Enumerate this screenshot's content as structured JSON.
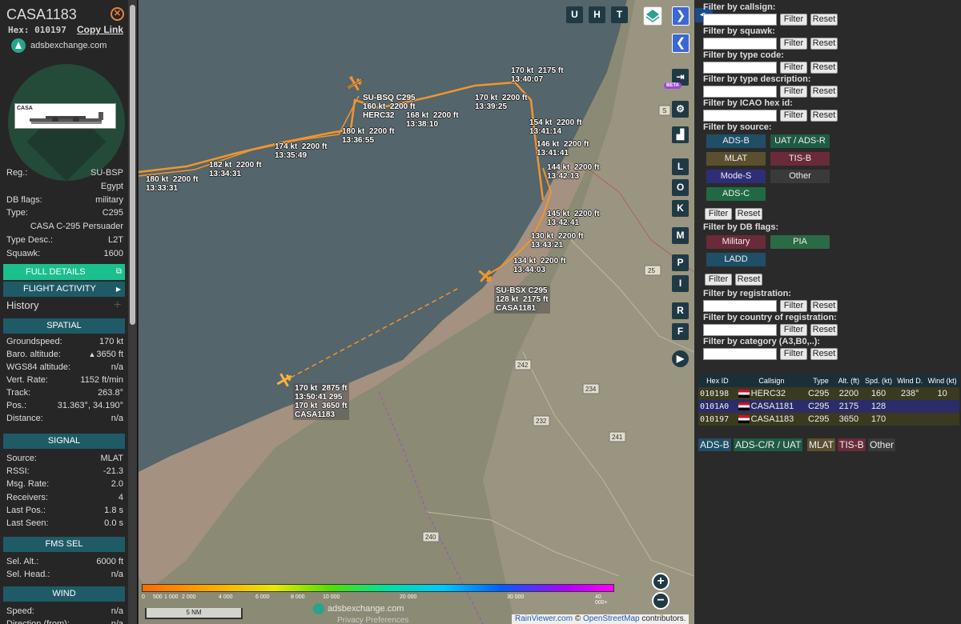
{
  "info": {
    "callsign": "CASA1183",
    "hex_label": "Hex:",
    "hex": "010197",
    "copy_link": "Copy Link",
    "brand": "adsbexchange.com",
    "photo_text": "CASA",
    "fields": [
      {
        "k": "Reg.:",
        "v": "SU-BSP"
      },
      {
        "k": "",
        "v": "Egypt"
      },
      {
        "k": "DB flags:",
        "v": "military"
      },
      {
        "k": "Type:",
        "v": "C295"
      },
      {
        "k": "",
        "v": "CASA C-295 Persuader"
      },
      {
        "k": "Type Desc.:",
        "v": "L2T"
      },
      {
        "k": "Squawk:",
        "v": "1600"
      }
    ],
    "full_details": "FULL DETAILS",
    "flight_activity": "FLIGHT ACTIVITY",
    "history": "History",
    "spatial_header": "SPATIAL",
    "spatial": [
      {
        "k": "Groundspeed:",
        "v": "170 kt"
      },
      {
        "k": "Baro. altitude:",
        "v": "3650 ft"
      },
      {
        "k": "WGS84 altitude:",
        "v": "n/a"
      },
      {
        "k": "Vert. Rate:",
        "v": "1152 ft/min"
      },
      {
        "k": "Track:",
        "v": "263.8°"
      },
      {
        "k": "Pos.:",
        "v": "31.363°, 34.190°"
      },
      {
        "k": "Distance:",
        "v": "n/a"
      }
    ],
    "signal_header": "SIGNAL",
    "signal": [
      {
        "k": "Source:",
        "v": "MLAT"
      },
      {
        "k": "RSSI:",
        "v": "-21.3"
      },
      {
        "k": "Msg. Rate:",
        "v": "2.0"
      },
      {
        "k": "Receivers:",
        "v": "4"
      },
      {
        "k": "Last Pos.:",
        "v": "1.8 s"
      },
      {
        "k": "Last Seen:",
        "v": "0.0 s"
      }
    ],
    "fms_header": "FMS SEL",
    "fms": [
      {
        "k": "Sel. Alt.:",
        "v": "6000 ft"
      },
      {
        "k": "Sel. Head.:",
        "v": "n/a"
      }
    ],
    "wind_header": "WIND",
    "wind": [
      {
        "k": "Speed:",
        "v": "n/a"
      },
      {
        "k": "Direction (from):",
        "v": "n/a"
      }
    ]
  },
  "map": {
    "buttons_top": [
      "U",
      "H",
      "T"
    ],
    "side_buttons": [
      "L",
      "O",
      "K",
      "M",
      "P",
      "I",
      "R",
      "F"
    ],
    "beta": "BETA",
    "zoom_in": "+",
    "zoom_out": "−",
    "scale": "5 NM",
    "watermark": "adsbexchange.com",
    "privacy": "Privacy Preferences",
    "attribution_1": "RainViewer.com",
    "attribution_sep": " © ",
    "attribution_2": "OpenStreetMap",
    "attribution_3": " contributors.",
    "legend_labels": [
      "0",
      "500",
      "1 000",
      "2 000",
      "4 000",
      "6 000",
      "8 000",
      "10 000",
      "20 000",
      "30 000",
      "40 000+"
    ],
    "road_labels": [
      "242",
      "234",
      "232",
      "241",
      "240",
      "25",
      "S"
    ],
    "aircraft": [
      {
        "label": "SU-BSQ C295\n160 kt  2200 ft\nHERC32"
      },
      {
        "label": "SU-BSX C295\n128 kt  2175 ft\nCASA1181"
      },
      {
        "label": "170 kt  2875 ft\n13:50:41 295\n170 kt  3650 ft\nCASA1183"
      }
    ],
    "track_labels": [
      "170 kt  2175 ft\n13:40:07",
      "170 kt  2200 ft\n13:39:25",
      "168 kt  2200 ft\n13:38:10",
      "180 kt  2200 ft\n13:36:55",
      "174 kt  2200 ft\n13:35:49",
      "182 kt  2200 ft\n13:34:31",
      "180 kt  2200 ft\n13:33:31",
      "154 kt  2200 ft\n13:41:14",
      "146 kt  2200 ft\n13:41:41",
      "144 kt  2200 ft\n13:42:13",
      "145 kt  2200 ft\n13:42:41",
      "130 kt  2200 ft\n13:43:21",
      "134 kt  2200 ft\n13:44:03"
    ]
  },
  "filters": {
    "labels": {
      "callsign": "Filter by callsign:",
      "squawk": "Filter by squawk:",
      "type_code": "Filter by type code:",
      "type_desc": "Filter by type description:",
      "icao": "Filter by ICAO hex id:",
      "source": "Filter by source:",
      "db_flags": "Filter by DB flags:",
      "registration": "Filter by registration:",
      "country": "Filter by country of registration:",
      "category": "Filter by category (A3,B0,..):"
    },
    "filter_btn": "Filter",
    "reset_btn": "Reset",
    "sources": [
      {
        "label": "ADS-B",
        "color": "#1f4f66"
      },
      {
        "label": "UAT / ADS-R",
        "color": "#1f5b44"
      },
      {
        "label": "MLAT",
        "color": "#5a5030"
      },
      {
        "label": "TIS-B",
        "color": "#6a2a3a"
      },
      {
        "label": "Mode-S",
        "color": "#2e2e78"
      },
      {
        "label": "Other",
        "color": "#3a3a3a"
      },
      {
        "label": "ADS-C",
        "color": "#1f6a44"
      }
    ],
    "db_flag_btns": [
      {
        "label": "Military",
        "color": "#6a2a3a"
      },
      {
        "label": "PIA",
        "color": "#2a6a44"
      },
      {
        "label": "LADD",
        "color": "#1f4f66"
      }
    ]
  },
  "table": {
    "headers": [
      "Hex ID",
      "Callsign",
      "Type",
      "Alt. (ft)",
      "Spd. (kt)",
      "Wind D.",
      "Wind (kt)"
    ],
    "rows": [
      {
        "hex": "010198",
        "callsign": "HERC32",
        "type": "C295",
        "alt": "2200",
        "spd": "160",
        "wind_d": "238°",
        "wind": "10"
      },
      {
        "hex": "0101A0",
        "callsign": "CASA1181",
        "type": "C295",
        "alt": "2175",
        "spd": "128",
        "wind_d": "",
        "wind": ""
      },
      {
        "hex": "010197",
        "callsign": "CASA1183",
        "type": "C295",
        "alt": "3650",
        "spd": "170",
        "wind_d": "",
        "wind": ""
      }
    ]
  },
  "source_legend": [
    {
      "label": "ADS-B",
      "color": "#1f4f66"
    },
    {
      "label": "ADS-C/R / UAT",
      "color": "#1f5b44"
    },
    {
      "label": "MLAT",
      "color": "#5a5030"
    },
    {
      "label": "TIS-B",
      "color": "#6a2a3a"
    },
    {
      "label": "Other",
      "color": "#3a3a3a"
    }
  ]
}
